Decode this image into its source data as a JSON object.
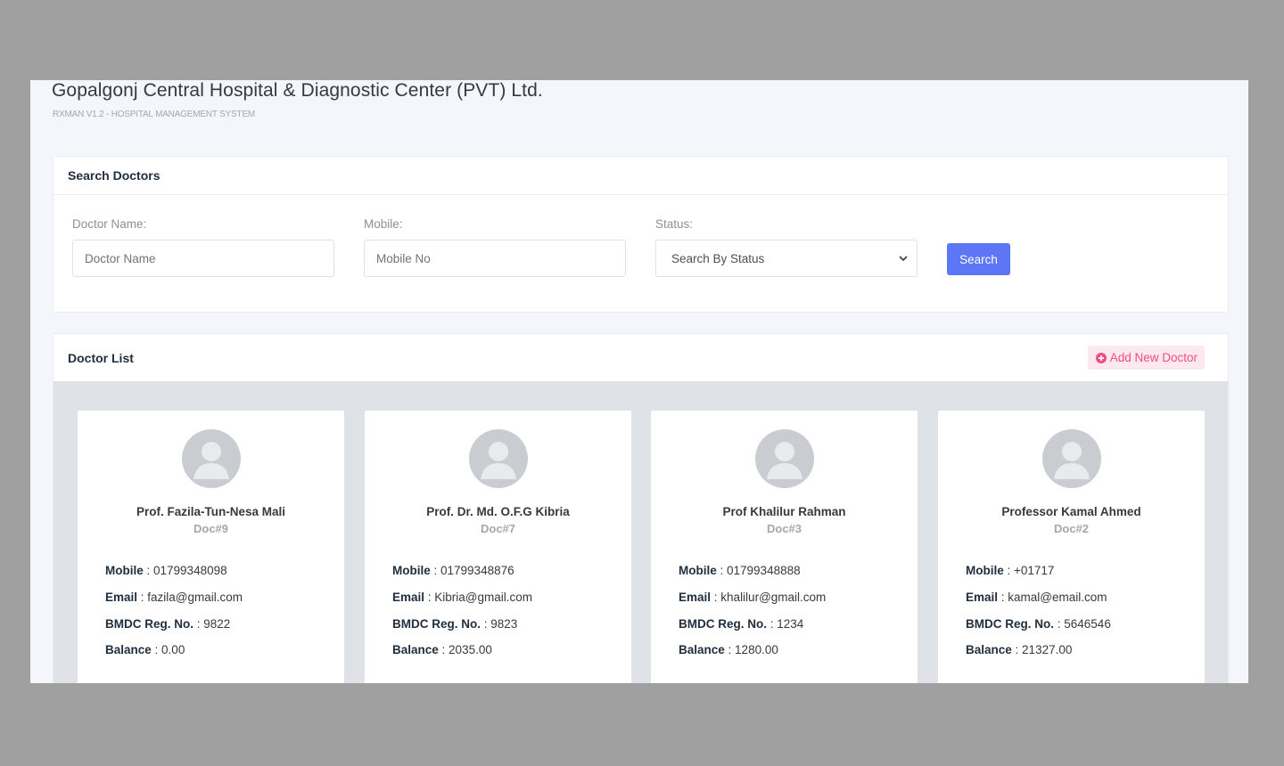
{
  "header": {
    "title": "Gopalgonj Central Hospital & Diagnostic Center (PVT) Ltd.",
    "subtitle": "RXMAN V1.2 - HOSPITAL MANAGEMENT SYSTEM"
  },
  "search": {
    "title": "Search Doctors",
    "name_label": "Doctor Name:",
    "name_placeholder": "Doctor Name",
    "mobile_label": "Mobile:",
    "mobile_placeholder": "Mobile No",
    "status_label": "Status:",
    "status_selected": "Search By Status",
    "button": "Search"
  },
  "list": {
    "title": "Doctor List",
    "add_button": "Add New Doctor",
    "field_labels": {
      "mobile": "Mobile",
      "email": "Email",
      "bmdc": "BMDC Reg. No.",
      "balance": "Balance"
    },
    "doctors": [
      {
        "name": "Prof. Fazila-Tun-Nesa Mali",
        "id": "Doc#9",
        "mobile": "01799348098",
        "email": "fazila@gmail.com",
        "bmdc": "9822",
        "balance": "0.00"
      },
      {
        "name": "Prof. Dr. Md. O.F.G Kibria",
        "id": "Doc#7",
        "mobile": "01799348876",
        "email": "Kibria@gmail.com",
        "bmdc": "9823",
        "balance": "2035.00"
      },
      {
        "name": "Prof Khalilur Rahman",
        "id": "Doc#3",
        "mobile": "01799348888",
        "email": "khalilur@gmail.com",
        "bmdc": "1234",
        "balance": "1280.00"
      },
      {
        "name": "Professor Kamal Ahmed",
        "id": "Doc#2",
        "mobile": "+01717",
        "email": "kamal@email.com",
        "bmdc": "5646546",
        "balance": "21327.00"
      }
    ]
  },
  "colors": {
    "primary": "#5c76f6",
    "add_button_text": "#ef4e7e",
    "add_button_bg": "#fde8ef",
    "list_body_bg": "#dfe2e6"
  },
  "icons": {
    "add": "plus-circle-icon",
    "avatar": "user-avatar-icon",
    "select": "chevron-down-icon"
  }
}
